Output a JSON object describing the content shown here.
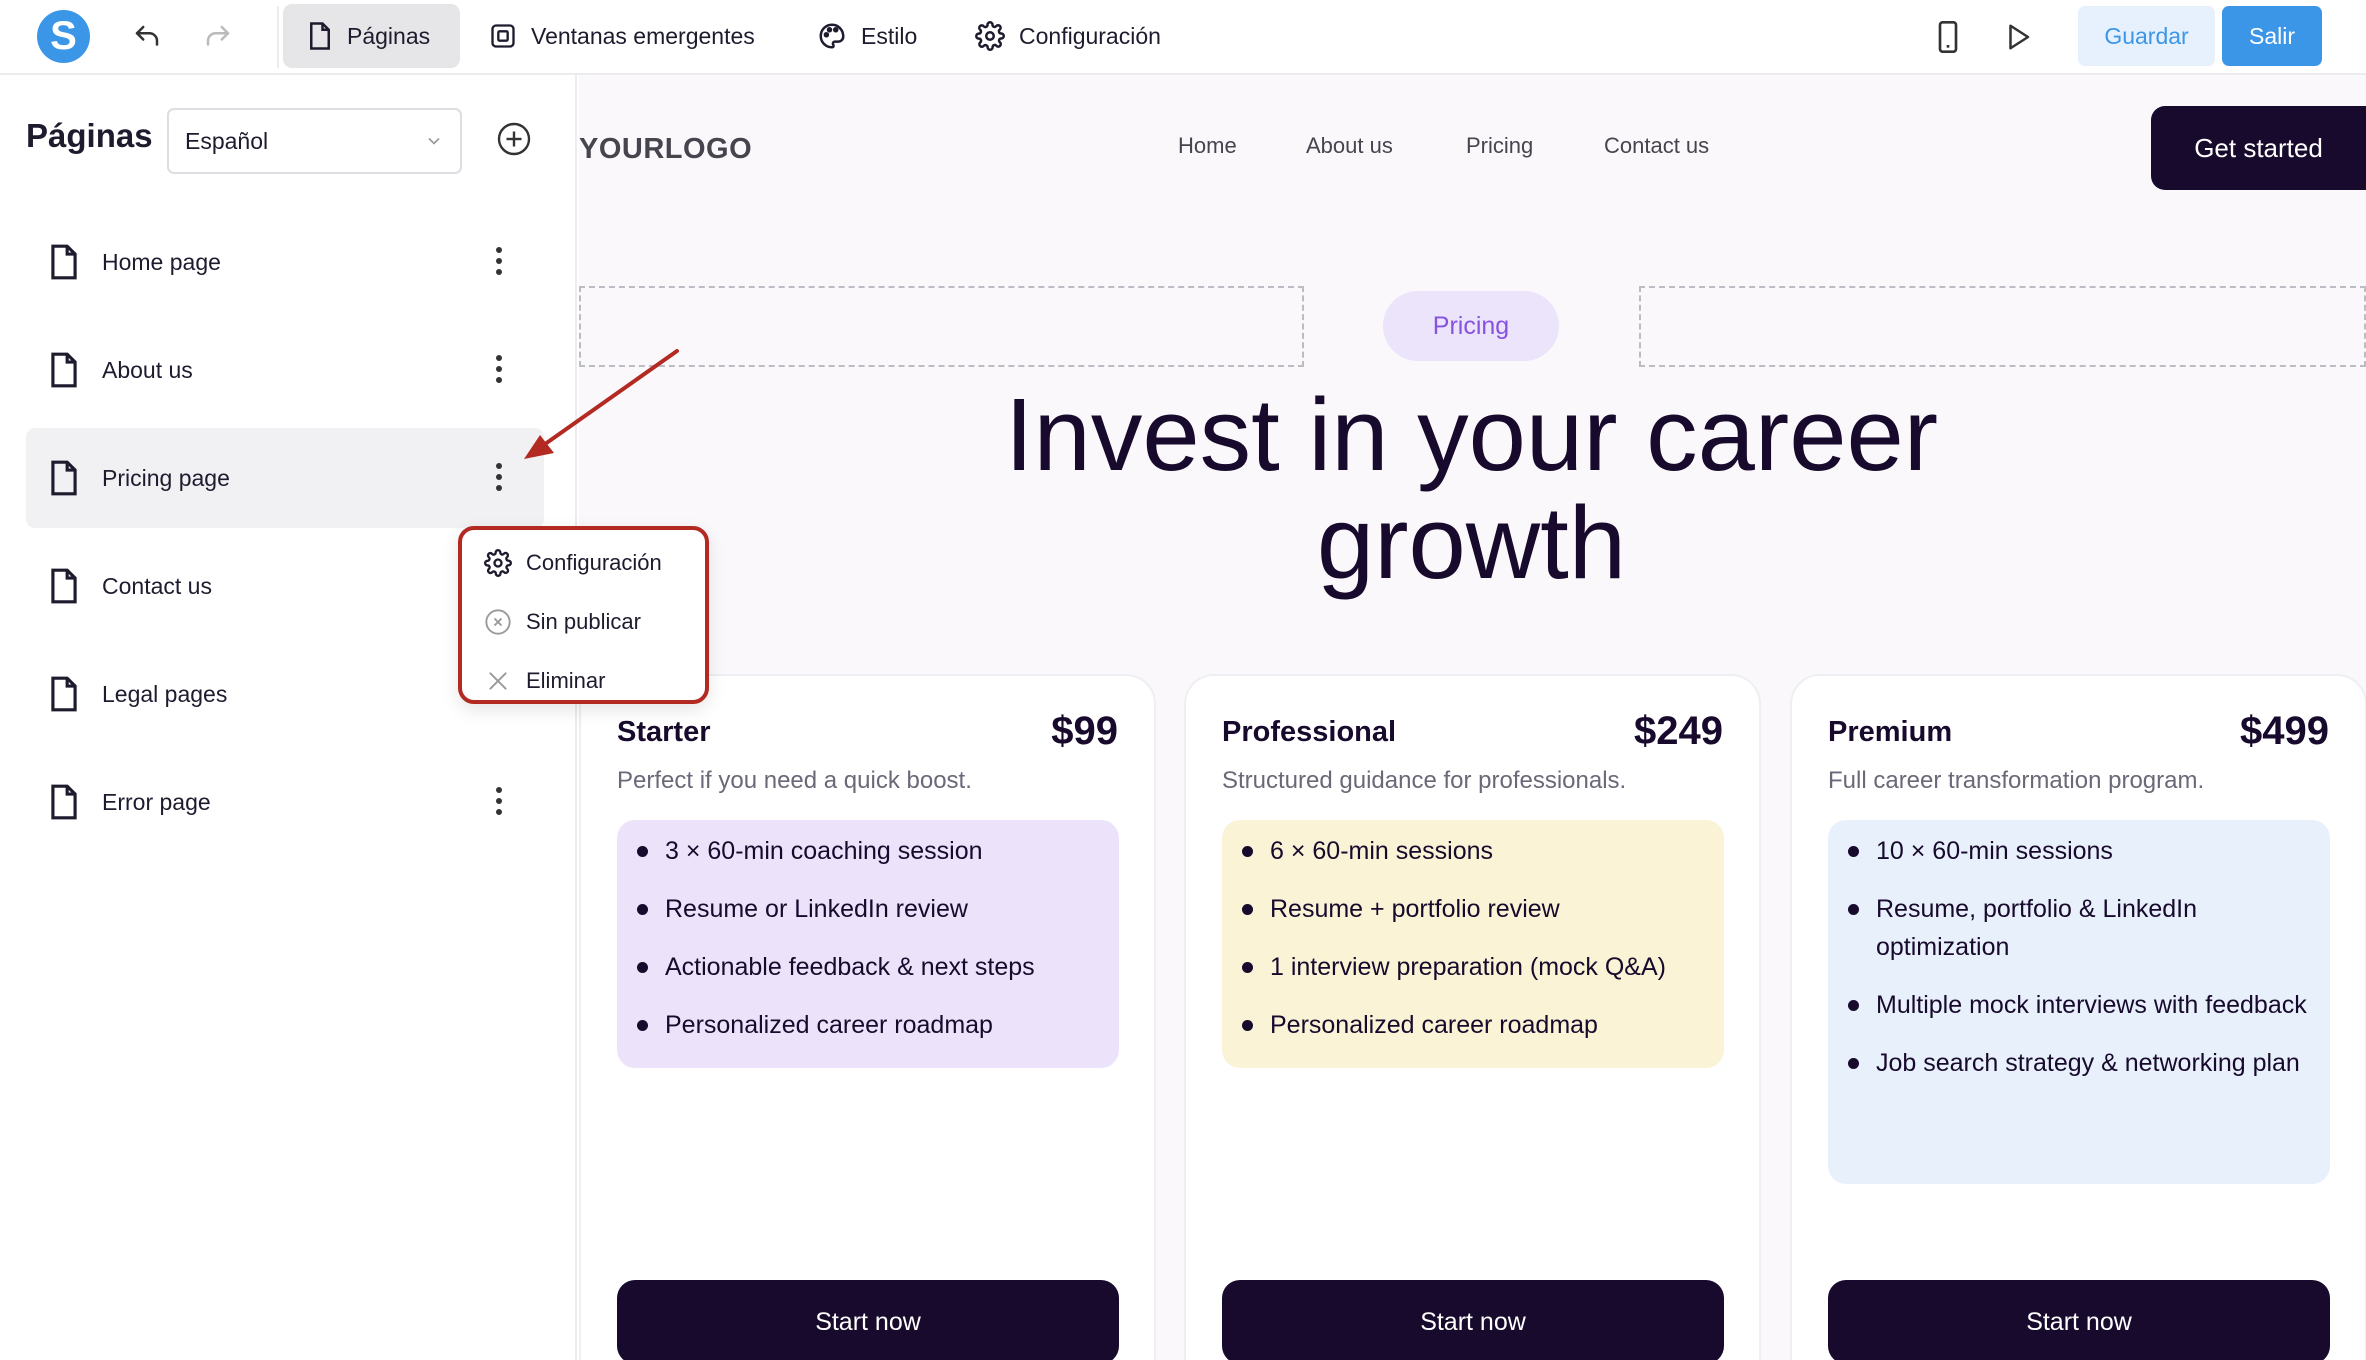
{
  "toolbar": {
    "logo_letter": "S",
    "tabs": [
      {
        "label": "Páginas",
        "icon": "page-icon",
        "active": true
      },
      {
        "label": "Ventanas emergentes",
        "icon": "popup-icon",
        "active": false
      },
      {
        "label": "Estilo",
        "icon": "palette-icon",
        "active": false
      },
      {
        "label": "Configuración",
        "icon": "gear-icon",
        "active": false
      }
    ],
    "save_label": "Guardar",
    "exit_label": "Salir",
    "accent": "#3b96e8"
  },
  "sidebar": {
    "title": "Páginas",
    "language": "Español",
    "pages": [
      {
        "label": "Home page"
      },
      {
        "label": "About us"
      },
      {
        "label": "Pricing page"
      },
      {
        "label": "Contact us"
      },
      {
        "label": "Legal pages"
      },
      {
        "label": "Error page"
      }
    ],
    "context_menu": {
      "items": [
        {
          "label": "Configuración",
          "icon": "gear-icon"
        },
        {
          "label": "Sin publicar",
          "icon": "circle-x-icon"
        },
        {
          "label": "Eliminar",
          "icon": "close-icon"
        }
      ]
    }
  },
  "site": {
    "logo": "YOURLOGO",
    "nav": [
      "Home",
      "About us",
      "Pricing",
      "Contact us"
    ],
    "cta": "Get started",
    "pill": "Pricing",
    "hero_line1": "Invest in your career",
    "hero_line2": "growth",
    "plans": [
      {
        "name": "Starter",
        "price": "$99",
        "desc": "Perfect if you need a quick boost.",
        "features": [
          "3 × 60-min coaching session",
          "Resume or LinkedIn review",
          "Actionable feedback & next steps",
          "Personalized career roadmap"
        ],
        "box_color": "#ece3fb",
        "button": "Start now"
      },
      {
        "name": "Professional",
        "price": "$249",
        "desc": "Structured guidance for professionals.",
        "features": [
          "6 × 60-min sessions",
          "Resume + portfolio review",
          "1 interview preparation (mock Q&A)",
          "Personalized career roadmap"
        ],
        "box_color": "#faf3d6",
        "button": "Start now"
      },
      {
        "name": "Premium",
        "price": "$499",
        "desc": "Full career transformation program.",
        "features": [
          "10 × 60-min sessions",
          "Resume, portfolio & LinkedIn optimization",
          "Multiple mock interviews with feedback",
          "Job search strategy & networking plan"
        ],
        "box_color": "#e8f0fb",
        "button": "Start now"
      }
    ]
  }
}
